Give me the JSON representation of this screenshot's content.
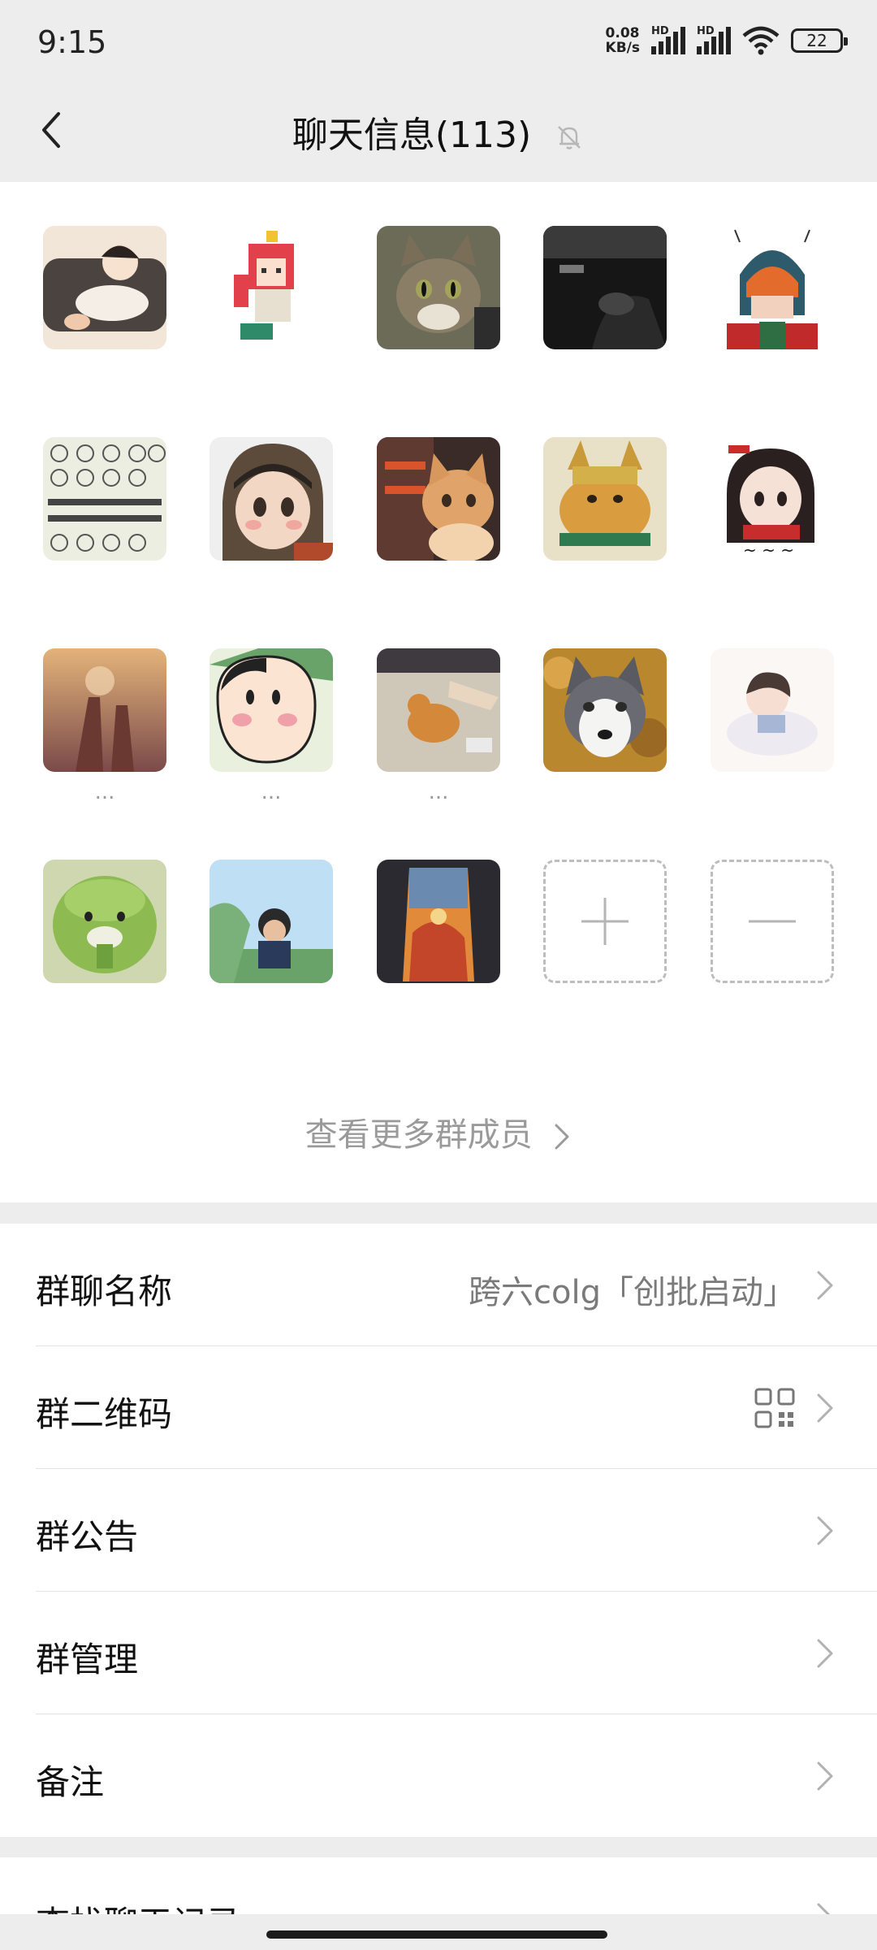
{
  "status_bar": {
    "time": "9:15",
    "net_speed_value": "0.08",
    "net_speed_unit": "KB/s",
    "signal_1_label": "HD",
    "signal_2_label": "HD",
    "battery": "22"
  },
  "header": {
    "title": "聊天信息(113)",
    "back_icon": "chevron-left-icon",
    "mute_icon": "bell-off-icon"
  },
  "members": [
    {
      "name": "",
      "avatar": "cartoon-baby-on-sofa"
    },
    {
      "name": "",
      "avatar": "pixel-art-red-hair-girl"
    },
    {
      "name": "",
      "avatar": "tabby-cat-photo"
    },
    {
      "name": "",
      "avatar": "dark-car-interior"
    },
    {
      "name": "",
      "avatar": "robot-helmet-anime"
    },
    {
      "name": "",
      "avatar": "rabbit-meme-text"
    },
    {
      "name": "",
      "avatar": "anime-girl-helmet"
    },
    {
      "name": "",
      "avatar": "orange-cat-window"
    },
    {
      "name": "",
      "avatar": "cat-with-crown"
    },
    {
      "name": "",
      "avatar": "anime-girl-crying"
    },
    {
      "name": "...",
      "avatar": "sunset-hands-bottles"
    },
    {
      "name": "...",
      "avatar": "crayon-shin-chan"
    },
    {
      "name": "...",
      "avatar": "dog-street-photo"
    },
    {
      "name": "",
      "avatar": "husky-dog-photo"
    },
    {
      "name": "",
      "avatar": "anime-boy-pillow"
    },
    {
      "name": "",
      "avatar": "green-cabbage-dog"
    },
    {
      "name": "",
      "avatar": "child-blue-sky"
    },
    {
      "name": "",
      "avatar": "sunset-jar-painting"
    }
  ],
  "add_member_icon": "plus-icon",
  "remove_member_icon": "minus-icon",
  "view_more": "查看更多群成员",
  "settings": [
    {
      "label": "群聊名称",
      "value": "跨六colg「创批启动」"
    },
    {
      "label": "群二维码",
      "value": "",
      "icon": "qr-code-icon"
    },
    {
      "label": "群公告",
      "value": ""
    },
    {
      "label": "群管理",
      "value": ""
    },
    {
      "label": "备注",
      "value": ""
    }
  ],
  "partial_row": {
    "label": "查找聊天记录"
  },
  "colors": {
    "background": "#ededed",
    "card": "#ffffff",
    "muted_text": "#9a9a9a"
  }
}
